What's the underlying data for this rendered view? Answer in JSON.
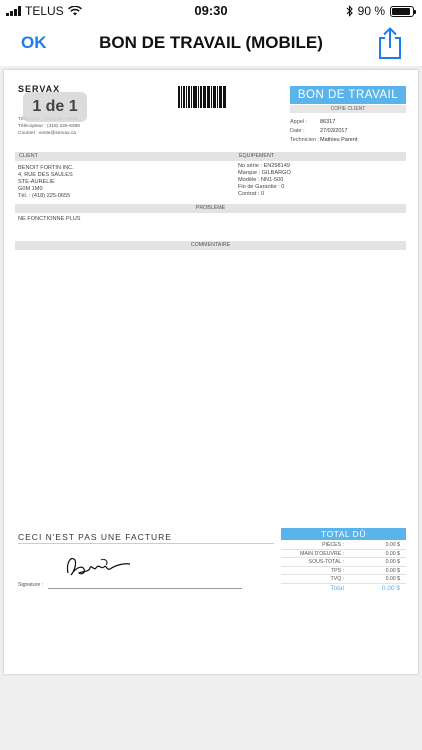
{
  "status_bar": {
    "carrier": "TELUS",
    "time": "09:30",
    "battery_percent_label": "90 %",
    "battery_level": 0.9
  },
  "nav": {
    "ok_label": "OK",
    "title": "BON DE TRAVAIL (MOBILE)",
    "share_icon": "share-icon"
  },
  "document": {
    "logo_text": "SERVAX",
    "company_lines": [
      "Téléphone : (418) 227-0650",
      "Télécopieur : (418) 225-6398",
      "Courriel : vente@servax.ca"
    ],
    "page_indicator": "1 de 1",
    "title": "BON DE TRAVAIL",
    "copy_label": "COPIE CLIENT",
    "appel_label": "Appel :",
    "appel_value": "86317",
    "date_label": "Date :",
    "date_value": "27/03/2017",
    "technicien_label": "Technicien :",
    "technicien_value": "Mathieu Parent",
    "client_header": "CLIENT",
    "equipement_header": "ÉQUIPEMENT",
    "client_lines": [
      "BENOIT FORTIN INC.",
      "4, RUE DES SAULES",
      "STE-AURELIE",
      "G0M 1M0",
      "Tél. : (418) 225-0655"
    ],
    "equipment_lines": [
      "No série : EN298149",
      "Marque : GILBARGO",
      "Modèle : NN1-500",
      "Fin de Garantie : 0",
      "Contrat : 0"
    ],
    "probleme_header": "PROBLÈME",
    "probleme_text": "NE FONCTIONNE PLUS",
    "commentaire_header": "COMMENTAIRE",
    "not_invoice": "CECI N'EST PAS UNE FACTURE",
    "signature_label": "Signature :",
    "total_header": "TOTAL DÛ",
    "totals": [
      {
        "label": "PIÈCES :",
        "value": "0.00 $"
      },
      {
        "label": "MAIN D'OEUVRE :",
        "value": "0.00 $"
      },
      {
        "label": "SOUS-TOTAL :",
        "value": "0.00 $"
      },
      {
        "label": "TPS :",
        "value": "0.00 $"
      },
      {
        "label": "TVQ :",
        "value": "0.00 $"
      }
    ],
    "total_label": "Total",
    "total_value": "0.00 $"
  },
  "colors": {
    "accent_blue": "#1a7ef0",
    "doc_blue": "#5ab4ec"
  }
}
